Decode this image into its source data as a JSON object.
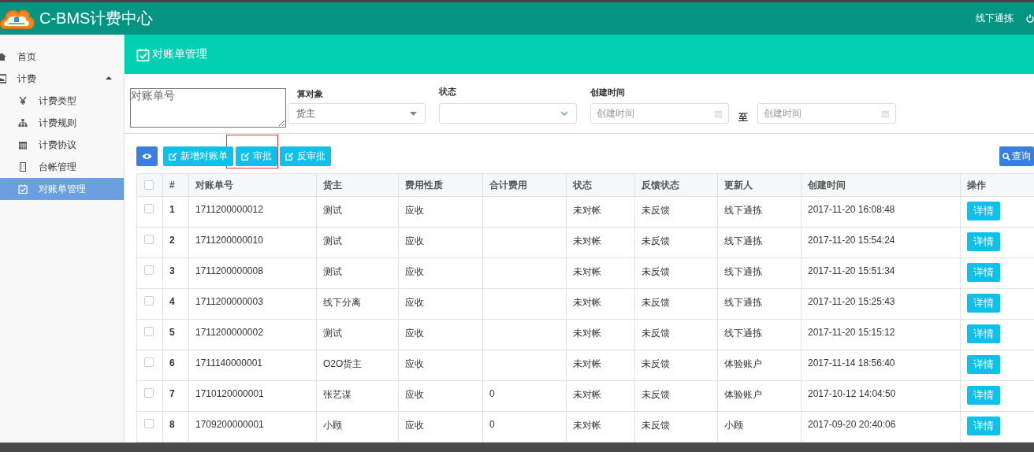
{
  "header": {
    "title": "C-BMS计费中心",
    "user": "线下通拣"
  },
  "sidebar": {
    "items": [
      {
        "label": "首页",
        "selected": false
      },
      {
        "label": "计费",
        "selected": false,
        "expanded": true,
        "children": [
          {
            "label": "计费类型",
            "selected": false
          },
          {
            "label": "计费规则",
            "selected": false
          },
          {
            "label": "计费协议",
            "selected": false
          },
          {
            "label": "台帐管理",
            "selected": false
          },
          {
            "label": "对账单管理",
            "selected": true
          }
        ]
      }
    ]
  },
  "page_title": "对账单管理",
  "filters": {
    "bill_no": {
      "placeholder": "对账单号"
    },
    "target": {
      "label": "算对象",
      "value": "货主"
    },
    "status": {
      "label": "状态"
    },
    "created": {
      "label": "创建时间",
      "from_placeholder": "创建时间",
      "separator": "至",
      "to_placeholder": "创建时间"
    }
  },
  "toolbar": {
    "buttons": [
      {
        "kind": "view",
        "highlighted": false
      },
      {
        "kind": "edit",
        "label": "新增对账单",
        "highlighted": false
      },
      {
        "kind": "edit",
        "label": "审批",
        "highlighted": true
      },
      {
        "kind": "edit",
        "label": "反审批",
        "highlighted": false
      }
    ],
    "search_button": "查询"
  },
  "table": {
    "all_checked": false,
    "columns": [
      "#",
      "对账单号",
      "货主",
      "费用性质",
      "合计费用",
      "状态",
      "反馈状态",
      "更新人",
      "创建时间",
      "操作"
    ],
    "rows": [
      {
        "checked": false,
        "cells": [
          "1",
          "1711200000012",
          "测试",
          "应收",
          "",
          "未对帐",
          "未反馈",
          "线下通拣",
          "2017-11-20 16:08:48"
        ],
        "action": "详情"
      },
      {
        "checked": false,
        "cells": [
          "2",
          "1711200000010",
          "测试",
          "应收",
          "",
          "未对帐",
          "未反馈",
          "线下通拣",
          "2017-11-20 15:54:24"
        ],
        "action": "详情"
      },
      {
        "checked": false,
        "cells": [
          "3",
          "1711200000008",
          "测试",
          "应收",
          "",
          "未对帐",
          "未反馈",
          "线下通拣",
          "2017-11-20 15:51:34"
        ],
        "action": "详情"
      },
      {
        "checked": false,
        "cells": [
          "4",
          "1711200000003",
          "线下分离",
          "应收",
          "",
          "未对帐",
          "未反馈",
          "线下通拣",
          "2017-11-20 15:25:43"
        ],
        "action": "详情"
      },
      {
        "checked": false,
        "cells": [
          "5",
          "1711200000002",
          "测试",
          "应收",
          "",
          "未对帐",
          "未反馈",
          "线下通拣",
          "2017-11-20 15:15:12"
        ],
        "action": "详情"
      },
      {
        "checked": false,
        "cells": [
          "6",
          "1711140000001",
          "O2O货主",
          "应收",
          "",
          "未对帐",
          "未反馈",
          "体验账户",
          "2017-11-14 18:56:40"
        ],
        "action": "详情"
      },
      {
        "checked": false,
        "cells": [
          "7",
          "1710120000001",
          "张艺谋",
          "应收",
          "0",
          "未对帐",
          "未反馈",
          "体验账户",
          "2017-10-12 14:04:50"
        ],
        "action": "详情"
      },
      {
        "checked": false,
        "cells": [
          "8",
          "1709200000001",
          "小顾",
          "应收",
          "0",
          "未对帐",
          "未反馈",
          "小顾",
          "2017-09-20 20:40:06"
        ],
        "action": "详情"
      }
    ]
  }
}
